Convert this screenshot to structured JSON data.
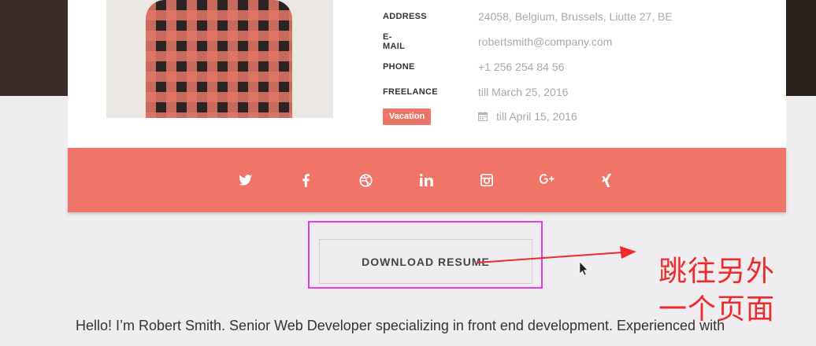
{
  "profile": {
    "rows": [
      {
        "key": "ADDRESS",
        "value": "24058, Belgium, Brussels, Liutte 27, BE"
      },
      {
        "key": "E-MAIL",
        "value": "robertsmith@company.com"
      },
      {
        "key": "PHONE",
        "value": "+1 256 254 84 56"
      },
      {
        "key": "FREELANCE",
        "value": "till March 25, 2016"
      }
    ],
    "vacation_label": "Vacation",
    "vacation_value": "till April 15, 2016"
  },
  "social": {
    "icons": [
      "twitter-icon",
      "facebook-icon",
      "dribbble-icon",
      "linkedin-icon",
      "instagram-icon",
      "google-plus-icon",
      "xing-icon"
    ],
    "bar_color": "#f07468"
  },
  "download_button": {
    "label": "DOWNLOAD RESUME"
  },
  "annotation": {
    "line1": "跳往另外",
    "line2": "一个页面",
    "color": "#ef2a2a",
    "highlight_color": "#e23ee6"
  },
  "bio": {
    "text": "Hello! I’m Robert Smith. Senior Web Developer specializing in front end development. Experienced with"
  }
}
